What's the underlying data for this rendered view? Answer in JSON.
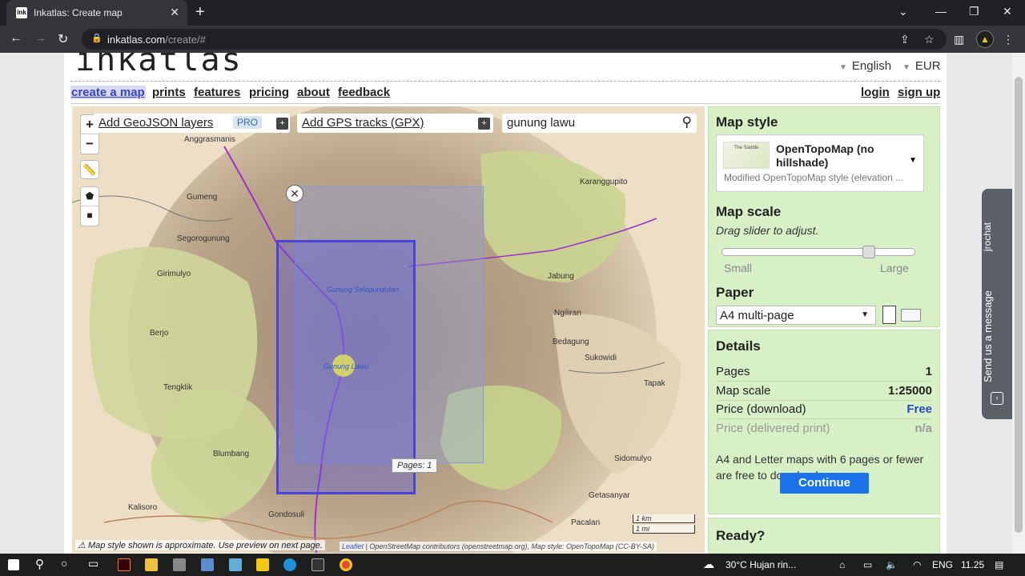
{
  "browser": {
    "tab_title": "Inkatlas: Create map",
    "favicon_text": "ink",
    "url_host": "inkatlas.com",
    "url_path": "/create/#"
  },
  "header": {
    "logo": "inkatlas",
    "language": "English",
    "currency": "EUR"
  },
  "nav": {
    "create": "create a map",
    "prints": "prints",
    "features": "features",
    "pricing": "pricing",
    "about": "about",
    "feedback": "feedback",
    "login": "login",
    "signup": "sign up"
  },
  "map": {
    "geojson_label": "Add GeoJSON layers",
    "pro_badge": "PRO",
    "gpx_label": "Add GPS tracks (GPX)",
    "search_value": "gunung lawu",
    "zoom_in": "+",
    "zoom_out": "−",
    "pages_badge": "Pages: 1",
    "warning": "Map style shown is approximate. Use preview on next page.",
    "attribution_leaflet": "Leaflet",
    "attribution_rest": " | OpenStreetMap contributors (openstreetmap.org), Map style: OpenTopoMap (CC-BY-SA)",
    "scale_km": "1 km",
    "scale_mi": "1 mi",
    "places": [
      {
        "name": "Anggrasmanis"
      },
      {
        "name": "Gumeng"
      },
      {
        "name": "Segorogunung"
      },
      {
        "name": "Girimulyo"
      },
      {
        "name": "Berjo"
      },
      {
        "name": "Tengklik"
      },
      {
        "name": "Blumbang"
      },
      {
        "name": "Kalisoro"
      },
      {
        "name": "Gondosuli"
      },
      {
        "name": "Karanggupito"
      },
      {
        "name": "Jabung"
      },
      {
        "name": "Ngiliran"
      },
      {
        "name": "Bedagung"
      },
      {
        "name": "Sukowidi"
      },
      {
        "name": "Tapak"
      },
      {
        "name": "Sidomulyo"
      },
      {
        "name": "Getasanyar"
      },
      {
        "name": "Pacalan"
      },
      {
        "name": "Gunung Selopundutan"
      },
      {
        "name": "Gunung Lawu"
      }
    ]
  },
  "sidebar": {
    "map_style_title": "Map style",
    "style_name": "OpenTopoMap (no hillshade)",
    "style_desc": "Modified OpenTopoMap style (elevation ...",
    "style_thumb": "The Saddle",
    "map_scale_title": "Map scale",
    "map_scale_hint": "Drag slider to adjust.",
    "scale_small": "Small",
    "scale_large": "Large",
    "scale_level": 0.78,
    "paper_title": "Paper",
    "paper_value": "A4 multi-page",
    "details_title": "Details",
    "details": [
      {
        "label": "Pages",
        "value": "1"
      },
      {
        "label": "Map scale",
        "value": "1:25000"
      },
      {
        "label": "Price (download)",
        "value": "Free"
      },
      {
        "label": "Price (delivered print)",
        "value": "n/a"
      }
    ],
    "details_note": "A4 and Letter maps with 6 pages or fewer are free to download.",
    "ready": "Ready?",
    "continue": "Continue"
  },
  "chat": {
    "brand": "jrochat",
    "message": "Send us a message"
  },
  "taskbar": {
    "weather": "30°C  Hujan rin...",
    "lang": "ENG",
    "time": "11.25"
  },
  "colors": {
    "accent_link": "#3a44c6",
    "panel_green": "#d8f0c6",
    "continue_blue": "#1a73e8",
    "selection_blue": "#4a45d8"
  }
}
